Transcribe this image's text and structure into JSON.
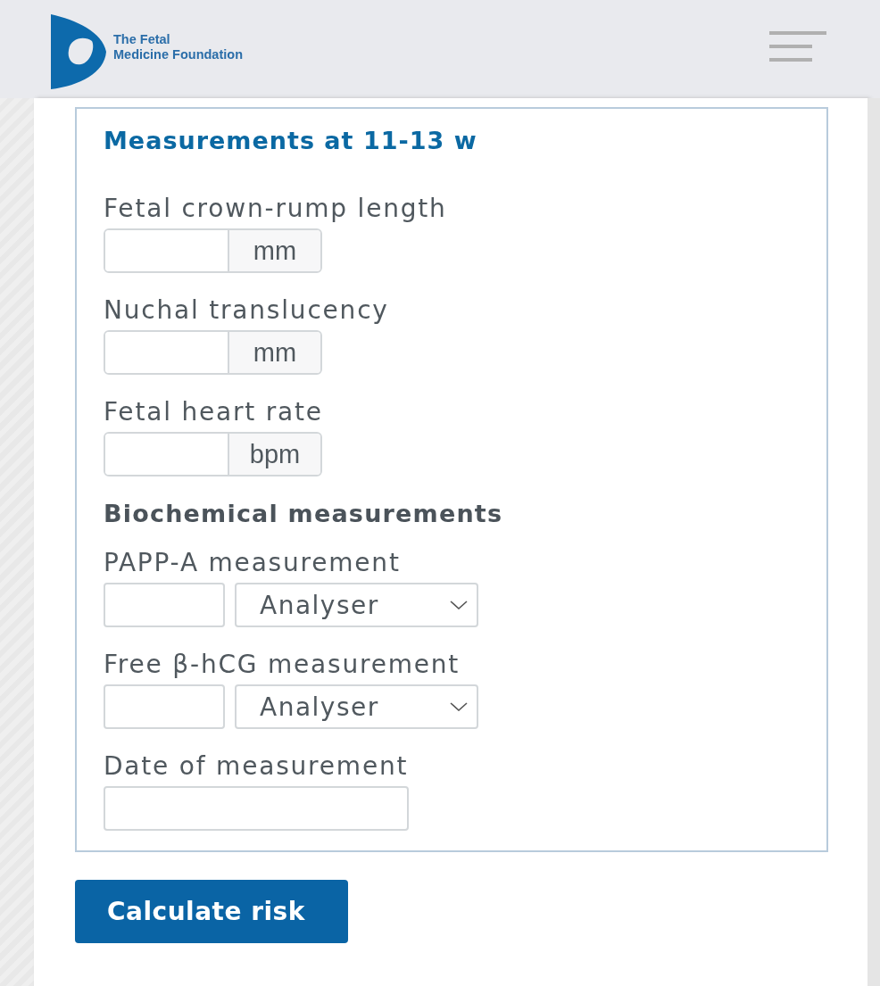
{
  "header": {
    "logo_lines": [
      "The Fetal",
      "Medicine Foundation"
    ]
  },
  "card": {
    "title": "Measurements at 11-13 w",
    "items": [
      {
        "kind": "unit",
        "label": "Fetal crown-rump length",
        "unit": "mm"
      },
      {
        "kind": "unit",
        "label": "Nuchal translucency",
        "unit": "mm"
      },
      {
        "kind": "unit",
        "label": "Fetal heart rate",
        "unit": "bpm"
      },
      {
        "kind": "heading",
        "text": "Biochemical measurements"
      },
      {
        "kind": "select",
        "label": "PAPP-A measurement",
        "option": "Analyser"
      },
      {
        "kind": "select",
        "label": "Free β-hCG measurement",
        "option": "Analyser"
      },
      {
        "kind": "date",
        "label": "Date of measurement"
      }
    ]
  },
  "button": "Calculate risk"
}
